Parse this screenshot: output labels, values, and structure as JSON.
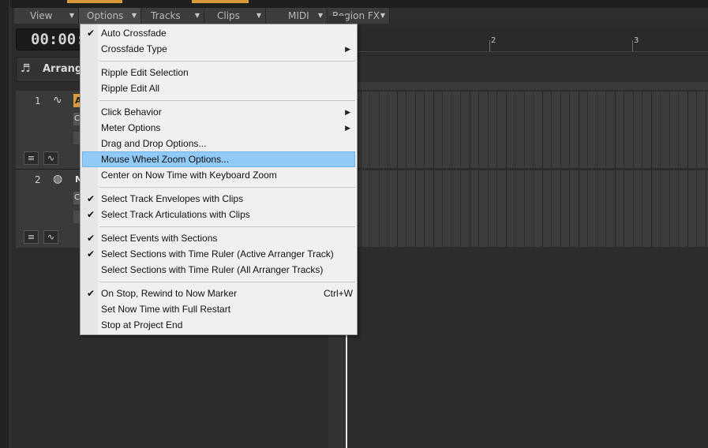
{
  "menubar": {
    "items": [
      {
        "label": "View"
      },
      {
        "label": "Options"
      },
      {
        "label": "Tracks"
      },
      {
        "label": "Clips"
      },
      {
        "label": "MIDI"
      },
      {
        "label": "Region FX"
      }
    ]
  },
  "transport": {
    "time": "00:00:"
  },
  "arranger": {
    "label": "Arrange"
  },
  "ruler": {
    "markers": [
      "2",
      "3"
    ]
  },
  "tracks": [
    {
      "number": "1",
      "icon": "waveform-icon",
      "name_initial": "A",
      "sub1": "C",
      "sub2": ""
    },
    {
      "number": "2",
      "icon": "midi-icon",
      "name_initial": "M",
      "sub1": "C",
      "sub2": ""
    }
  ],
  "options_menu": {
    "groups": [
      [
        {
          "label": "Auto Crossfade",
          "checked": true,
          "submenu": false,
          "shortcut": ""
        },
        {
          "label": "Crossfade Type",
          "checked": false,
          "submenu": true,
          "shortcut": ""
        }
      ],
      [
        {
          "label": "Ripple Edit Selection",
          "checked": false,
          "submenu": false,
          "shortcut": ""
        },
        {
          "label": "Ripple Edit All",
          "checked": false,
          "submenu": false,
          "shortcut": ""
        }
      ],
      [
        {
          "label": "Click Behavior",
          "checked": false,
          "submenu": true,
          "shortcut": ""
        },
        {
          "label": "Meter Options",
          "checked": false,
          "submenu": true,
          "shortcut": ""
        },
        {
          "label": "Drag and Drop Options...",
          "checked": false,
          "submenu": false,
          "shortcut": ""
        },
        {
          "label": "Mouse Wheel Zoom Options...",
          "checked": false,
          "submenu": false,
          "shortcut": "",
          "highlighted": true
        },
        {
          "label": "Center on Now Time with Keyboard Zoom",
          "checked": false,
          "submenu": false,
          "shortcut": ""
        }
      ],
      [
        {
          "label": "Select Track Envelopes with Clips",
          "checked": true,
          "submenu": false,
          "shortcut": ""
        },
        {
          "label": "Select Track Articulations with Clips",
          "checked": true,
          "submenu": false,
          "shortcut": ""
        }
      ],
      [
        {
          "label": "Select Events with Sections",
          "checked": true,
          "submenu": false,
          "shortcut": ""
        },
        {
          "label": "Select Sections with Time Ruler (Active Arranger Track)",
          "checked": true,
          "submenu": false,
          "shortcut": ""
        },
        {
          "label": "Select Sections with Time Ruler (All Arranger Tracks)",
          "checked": false,
          "submenu": false,
          "shortcut": ""
        }
      ],
      [
        {
          "label": "On Stop, Rewind to Now Marker",
          "checked": true,
          "submenu": false,
          "shortcut": "Ctrl+W"
        },
        {
          "label": "Set Now Time with Full Restart",
          "checked": false,
          "submenu": false,
          "shortcut": ""
        },
        {
          "label": "Stop at Project End",
          "checked": false,
          "submenu": false,
          "shortcut": ""
        }
      ]
    ]
  },
  "colors": {
    "accent": "#d99a3c",
    "highlight": "#91c9f7",
    "menu_bg": "#f0f0f0"
  }
}
